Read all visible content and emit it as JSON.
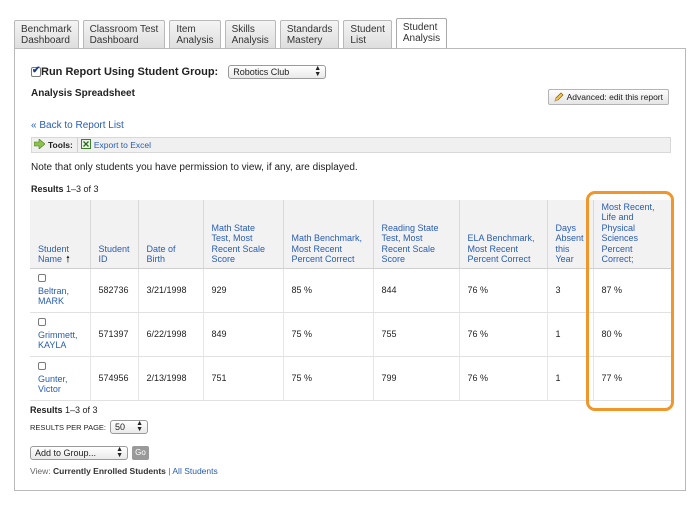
{
  "tabs": [
    {
      "label": "Benchmark\nDashboard",
      "active": false
    },
    {
      "label": "Classroom Test\nDashboard",
      "active": false
    },
    {
      "label": "Item\nAnalysis",
      "active": false
    },
    {
      "label": "Skills\nAnalysis",
      "active": false
    },
    {
      "label": "Standards\nMastery",
      "active": false
    },
    {
      "label": "Student\nList",
      "active": false
    },
    {
      "label": "Student\nAnalysis",
      "active": true
    }
  ],
  "group": {
    "checkbox_label": "Run Report Using Student Group:",
    "selected": "Robotics Club",
    "checked": true
  },
  "page_title": "Analysis Spreadsheet",
  "advanced_button": "Advanced: edit this report",
  "back_link": "« Back to Report List",
  "toolbar": {
    "tools_label": "Tools:",
    "export_label": "Export to Excel"
  },
  "note": "Note that only students you have permission to view, if any, are displayed.",
  "results_top": {
    "label": "Results",
    "range": "1–3 of 3"
  },
  "results_bottom": {
    "label": "Results",
    "range": "1–3 of 3"
  },
  "table": {
    "headers": [
      "Student\nName",
      "Student\nID",
      "Date of\nBirth",
      "Math State\nTest, Most\nRecent Scale\nScore",
      "Math Benchmark,\nMost Recent\nPercent Correct",
      "Reading State\nTest, Most\nRecent Scale\nScore",
      "ELA Benchmark,\nMost Recent\nPercent Correct",
      "Days\nAbsent\nthis\nYear",
      "Most Recent,\nLife and\nPhysical\nSciences\nPercent\nCorrect;"
    ],
    "rows": [
      [
        "Beltran,\nMARK",
        "582736",
        "3/21/1998",
        "929",
        "85 %",
        "844",
        "76 %",
        "3",
        "87 %"
      ],
      [
        "Grimmett,\nKAYLA",
        "571397",
        "6/22/1998",
        "849",
        "75 %",
        "755",
        "76 %",
        "1",
        "80 %"
      ],
      [
        "Gunter,\nVictor",
        "574956",
        "2/13/1998",
        "751",
        "75 %",
        "799",
        "76 %",
        "1",
        "77 %"
      ]
    ]
  },
  "per_page": {
    "label": "RESULTS PER PAGE:",
    "value": "50"
  },
  "add_group": {
    "select_value": "Add to Group...",
    "go_label": "Go"
  },
  "view": {
    "prefix": "View:",
    "current": "Currently Enrolled Students",
    "separator": "|",
    "all": "All Students"
  },
  "colors": {
    "link": "#2a5db0",
    "highlight": "#f0962b",
    "header_bg": "#f2f2f2"
  }
}
